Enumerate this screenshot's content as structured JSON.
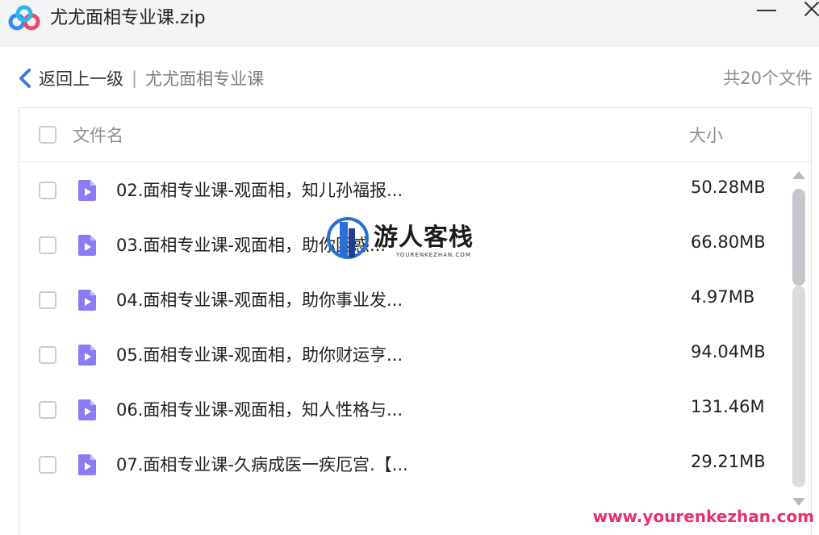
{
  "window": {
    "title": "尤尤面相专业课.zip",
    "logo_icon": "baidu-netdisk-cloud-icon",
    "minimize_icon": "minimize-icon",
    "close_icon": "close-icon"
  },
  "nav": {
    "back_label": "返回上一级",
    "separator": "|",
    "current_folder": "尤尤面相专业课",
    "file_count": "共20个文件"
  },
  "table": {
    "columns": {
      "name": "文件名",
      "size": "大小"
    },
    "rows": [
      {
        "name": "02.面相专业课-观面相，知儿孙福报...",
        "size": "50.28MB",
        "icon": "video-file-icon"
      },
      {
        "name": "03.面相专业课-观面相，助你困惑...",
        "size": "66.80MB",
        "icon": "video-file-icon"
      },
      {
        "name": "04.面相专业课-观面相，助你事业发...",
        "size": "4.97MB",
        "icon": "video-file-icon"
      },
      {
        "name": "05.面相专业课-观面相，助你财运亨...",
        "size": "94.04MB",
        "icon": "video-file-icon"
      },
      {
        "name": "06.面相专业课-观面相，知人性格与...",
        "size": "131.46M",
        "icon": "video-file-icon"
      },
      {
        "name": "07.面相专业课-久病成医一疾厄宫.【...",
        "size": "29.21MB",
        "icon": "video-file-icon"
      }
    ]
  },
  "watermark": {
    "name": "游人客栈",
    "sub": "YOURENKEZHAN.COM",
    "url": "www.yourenkezhan.com"
  },
  "colors": {
    "accent": "#3d7be0",
    "file_icon": "#8b7cf6",
    "watermark_url": "#e8306a"
  }
}
